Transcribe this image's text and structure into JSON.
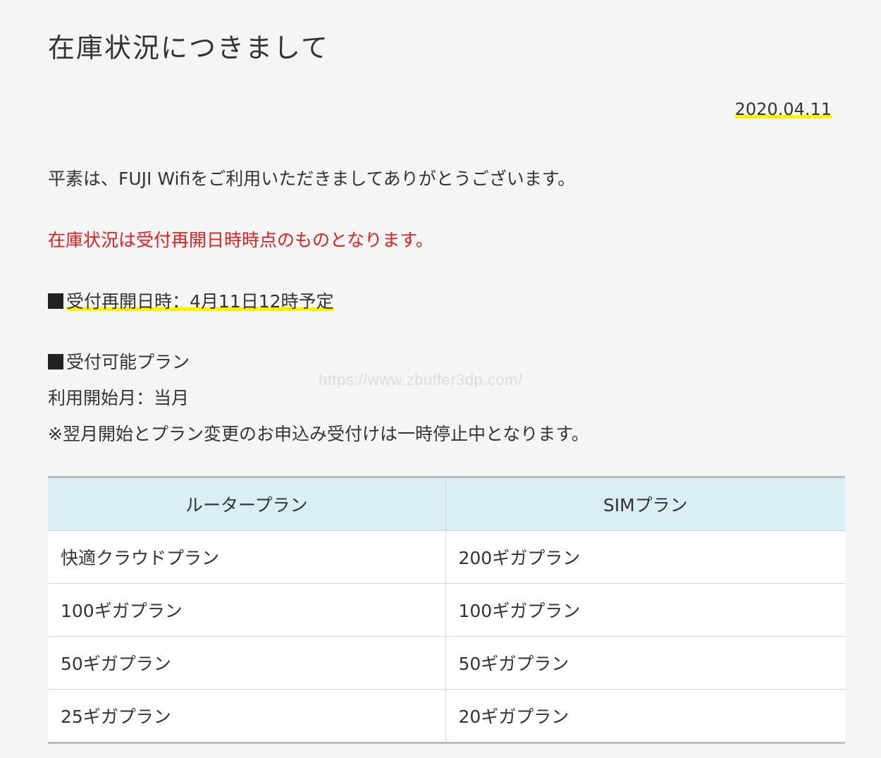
{
  "page": {
    "title": "在庫状況につきまして",
    "date": "2020.04.11",
    "greeting": "平素は、FUJI Wifiをご利用いただきましてありがとうございます。",
    "notice": "在庫状況は受付再開日時時点のものとなります。",
    "reopen_label": "受付再開日時：4月11日12時予定",
    "plans_heading": "受付可能プラン",
    "start_month": "利用開始月：当月",
    "note": "※翌月開始とプラン変更のお申込み受付けは一時停止中となります。",
    "watermark": "https://www.zbuffer3dp.com/",
    "colors": {
      "notice": "#e02020",
      "highlight": "#fff200",
      "table_header": "#d9eef5"
    }
  },
  "table": {
    "headers": [
      "ルータープラン",
      "SIMプラン"
    ],
    "rows": [
      [
        "快適クラウドプラン",
        "200ギガプラン"
      ],
      [
        "100ギガプラン",
        "100ギガプラン"
      ],
      [
        "50ギガプラン",
        "50ギガプラン"
      ],
      [
        "25ギガプラン",
        "20ギガプラン"
      ]
    ]
  }
}
